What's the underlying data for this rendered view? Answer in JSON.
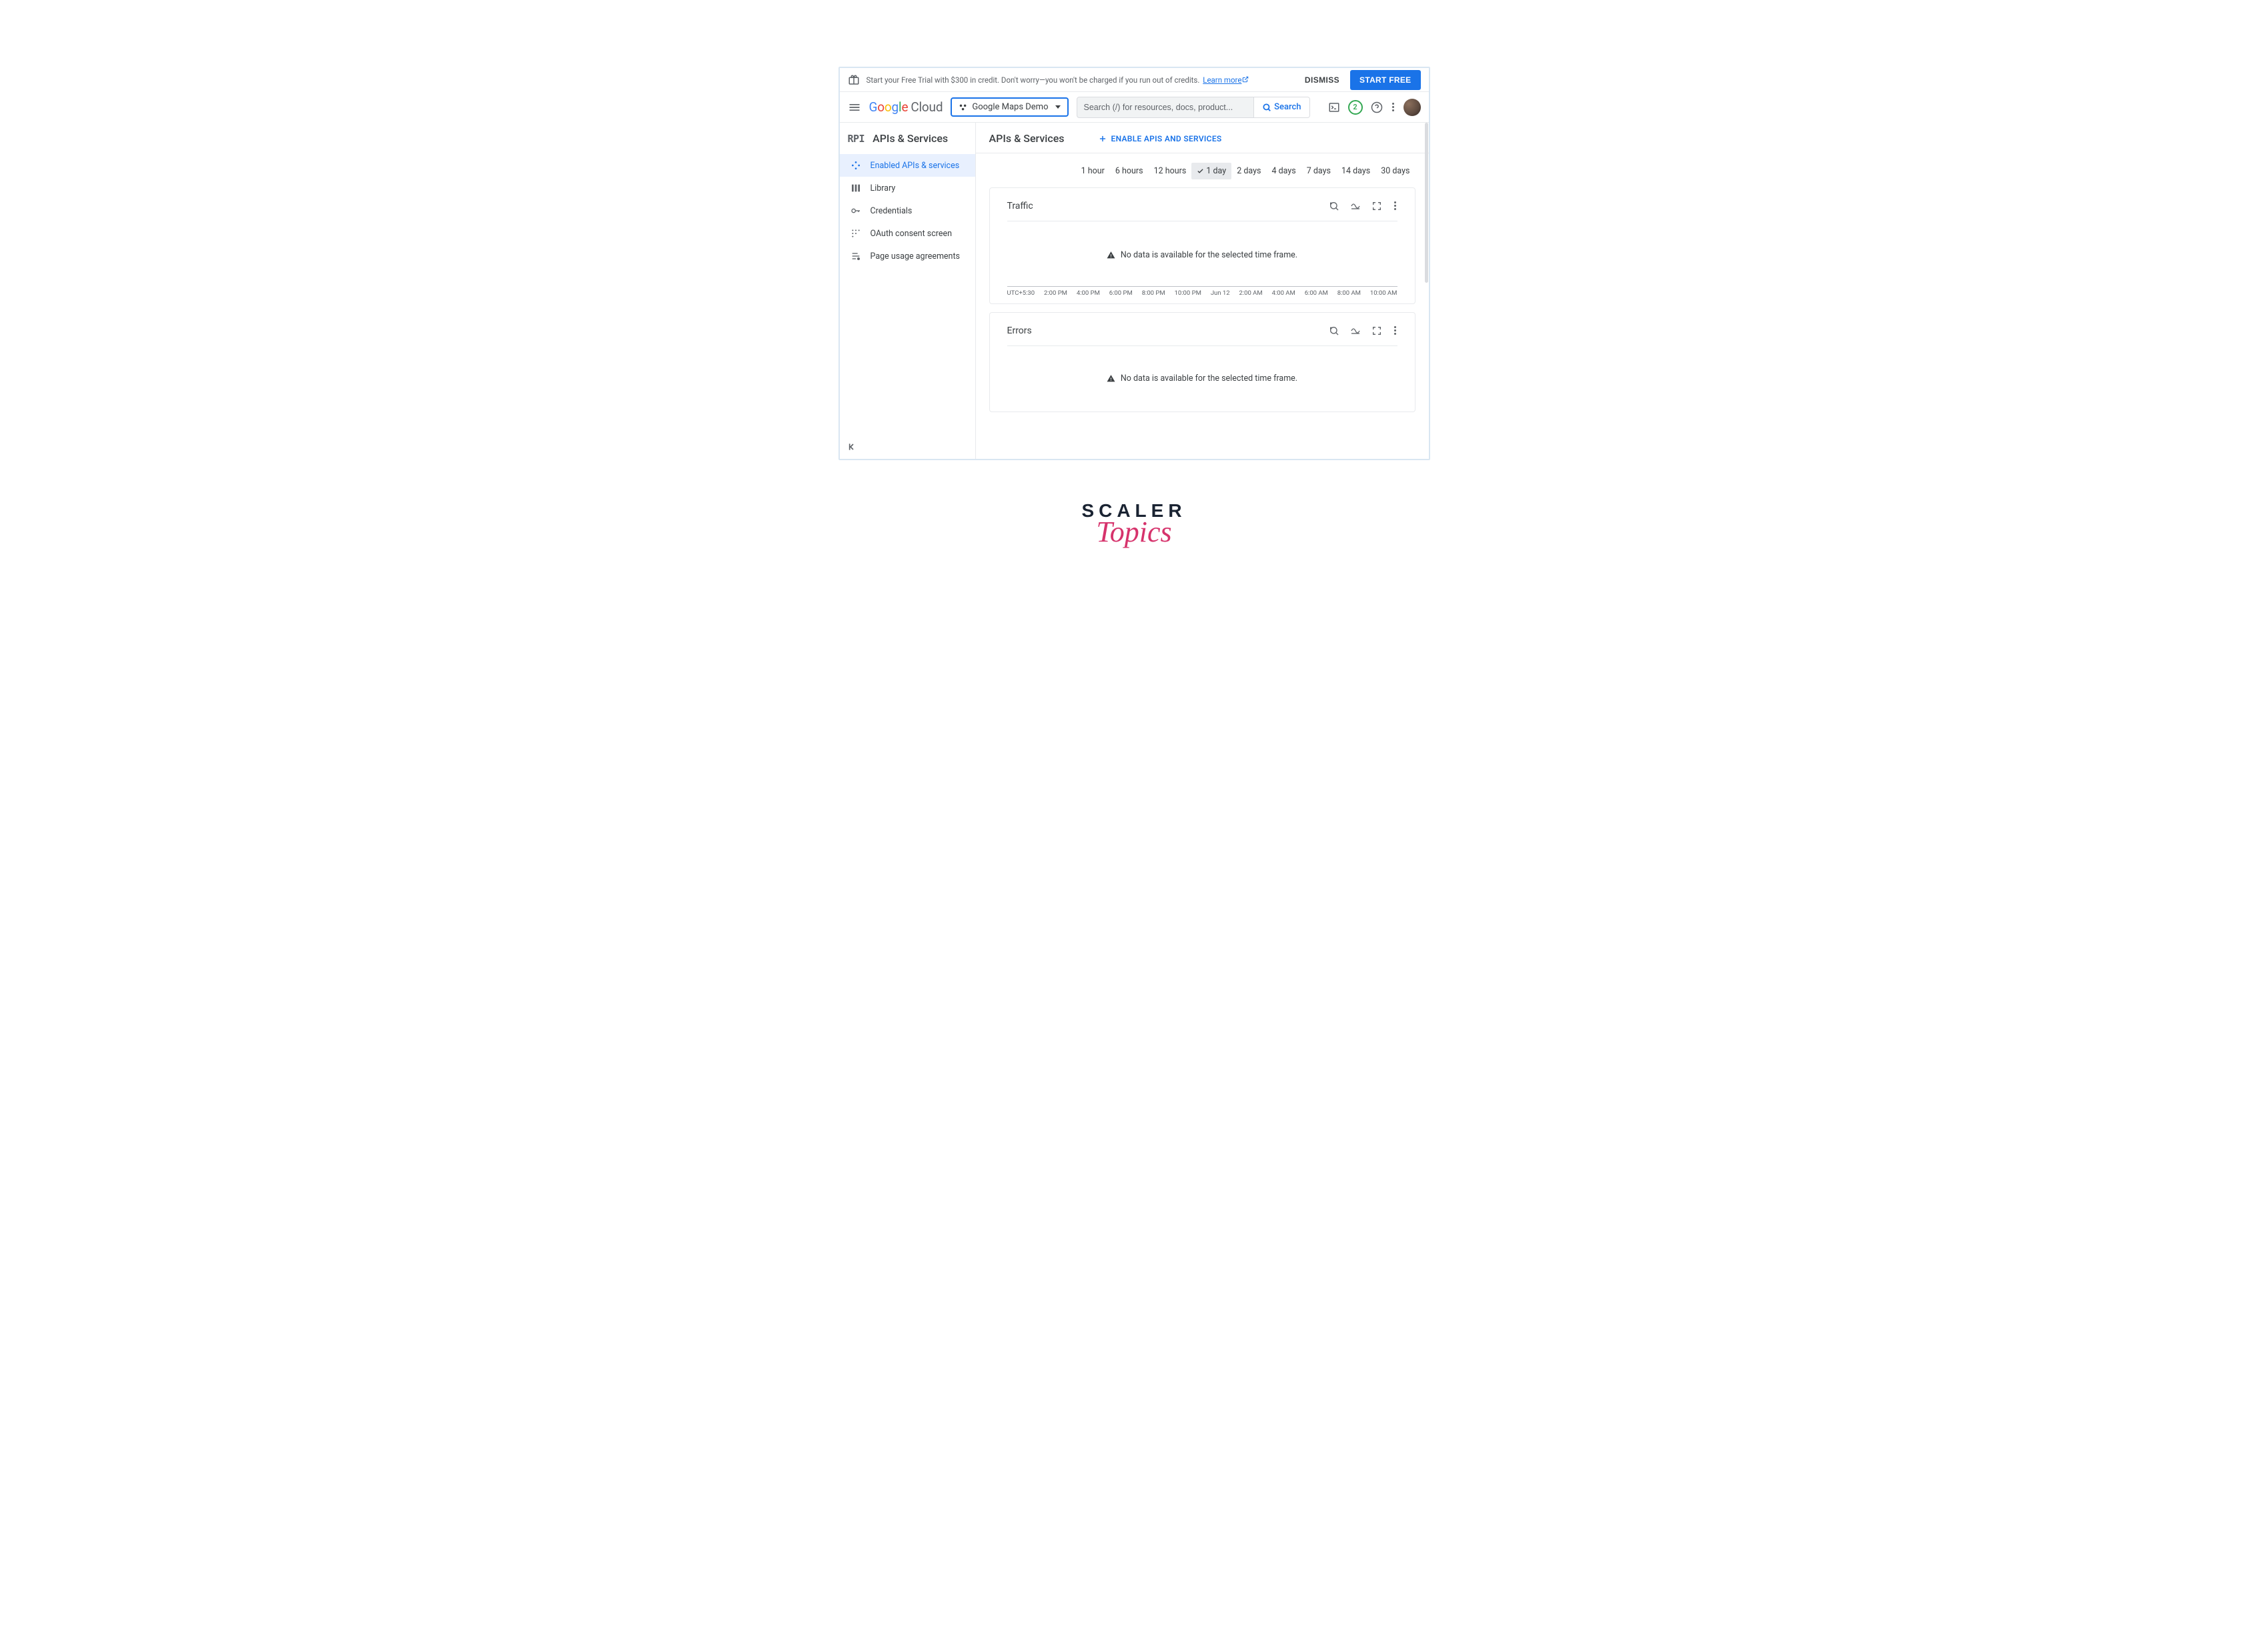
{
  "banner": {
    "text": "Start your Free Trial with $300 in credit. Don't worry—you won't be charged if you run out of credits.",
    "learn_more": "Learn more",
    "dismiss": "DISMISS",
    "start_free": "START FREE"
  },
  "topbar": {
    "project_label": "Google Maps Demo",
    "search_placeholder": "Search (/) for resources, docs, product...",
    "search_button": "Search",
    "badge_count": "2"
  },
  "sidebar": {
    "header": "APIs & Services",
    "items": [
      {
        "label": "Enabled APIs & services"
      },
      {
        "label": "Library"
      },
      {
        "label": "Credentials"
      },
      {
        "label": "OAuth consent screen"
      },
      {
        "label": "Page usage agreements"
      }
    ]
  },
  "main": {
    "title": "APIs & Services",
    "enable_button": "ENABLE APIS AND SERVICES",
    "time_ranges": [
      "1 hour",
      "6 hours",
      "12 hours",
      "1 day",
      "2 days",
      "4 days",
      "7 days",
      "14 days",
      "30 days"
    ],
    "selected_range": "1 day",
    "cards": {
      "traffic": {
        "title": "Traffic",
        "nodata_message": "No data is available for the selected time frame.",
        "ticks": [
          "UTC+5:30",
          "2:00 PM",
          "4:00 PM",
          "6:00 PM",
          "8:00 PM",
          "10:00 PM",
          "Jun 12",
          "2:00 AM",
          "4:00 AM",
          "6:00 AM",
          "8:00 AM",
          "10:00 AM"
        ]
      },
      "errors": {
        "title": "Errors",
        "nodata_message": "No data is available for the selected time frame."
      }
    }
  },
  "watermark": {
    "line1": "SCALER",
    "line2": "Topics"
  }
}
